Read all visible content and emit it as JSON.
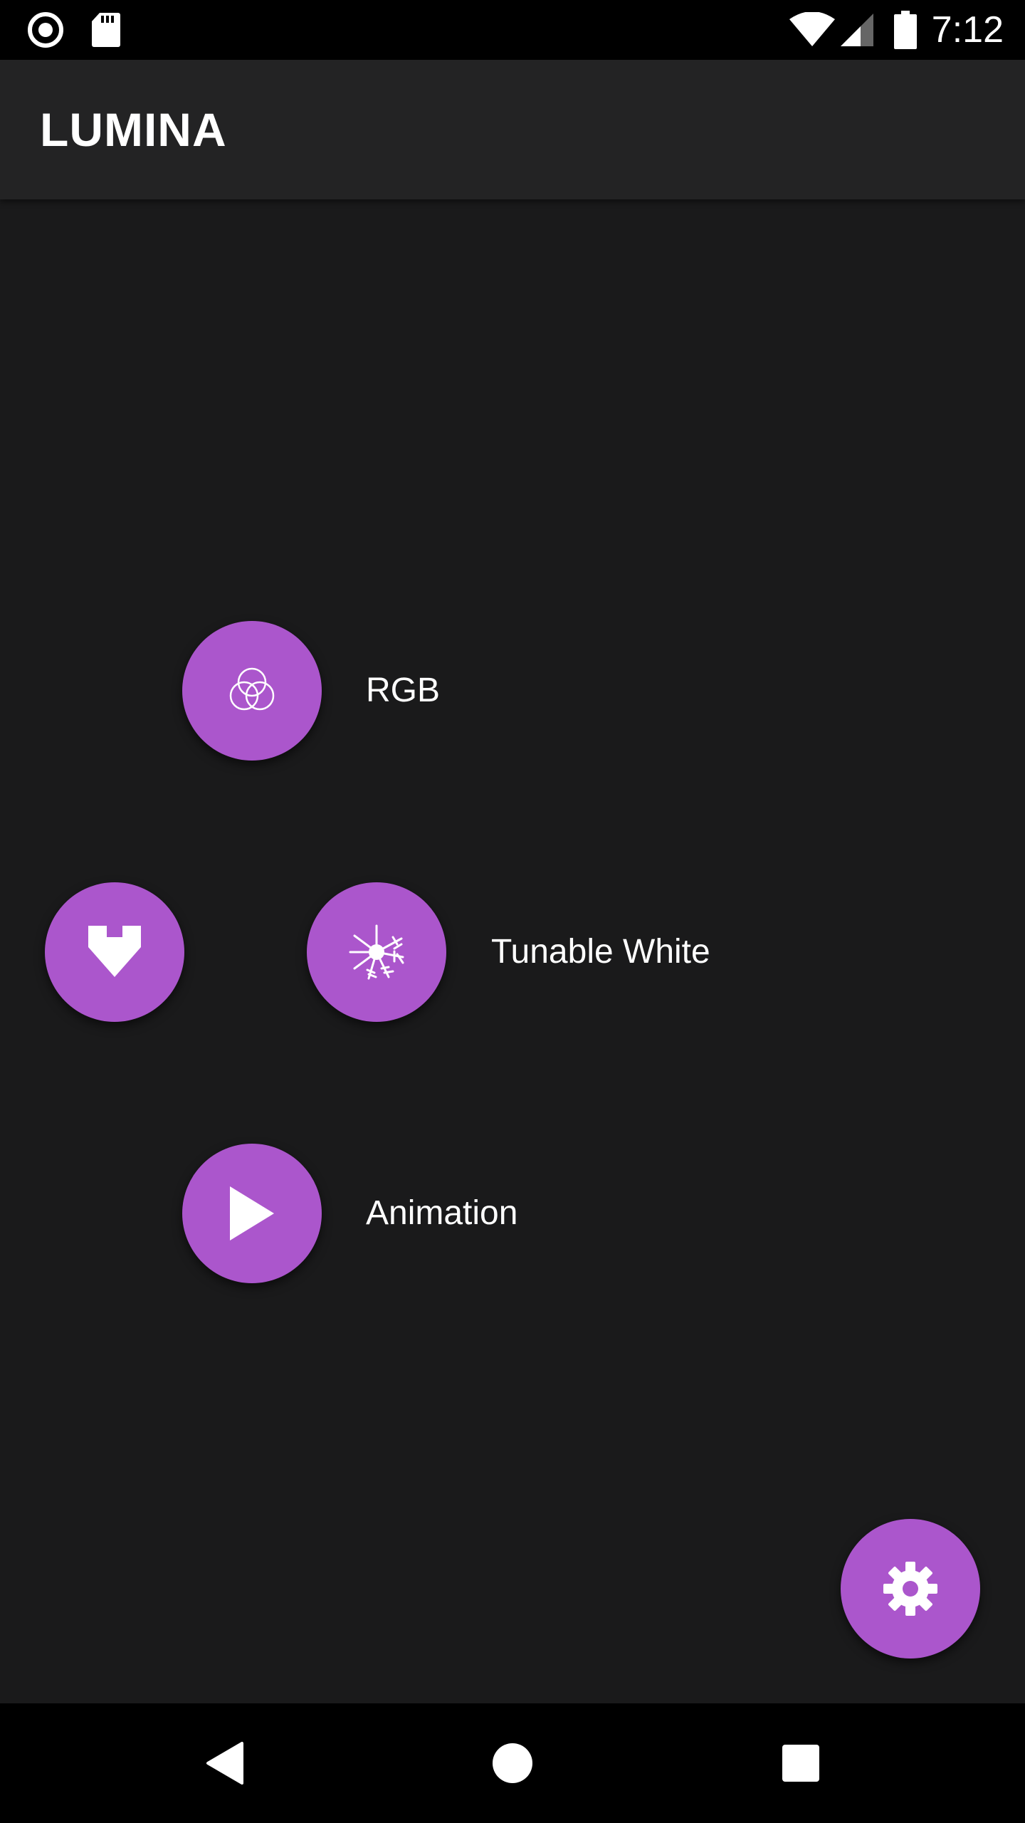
{
  "status_bar": {
    "time": "7:12",
    "icons": [
      "radio-record-icon",
      "sd-card-icon",
      "wifi-icon",
      "cell-signal-icon",
      "battery-icon"
    ]
  },
  "app_bar": {
    "title": "LUMINA"
  },
  "menu": {
    "items": [
      {
        "label": "RGB",
        "icon": "rgb-circles-icon"
      },
      {
        "label": "Tunable White",
        "icon": "sun-snowflake-icon"
      },
      {
        "label": "Animation",
        "icon": "play-icon"
      }
    ],
    "collapse_icon": "arrow-down-icon"
  },
  "settings_fab": {
    "icon": "gear-icon"
  },
  "nav_bar": {
    "icons": [
      "back-icon",
      "home-icon",
      "recents-icon"
    ]
  },
  "colors": {
    "accent": "#ab56cc",
    "background": "#1a1a1b",
    "app_bar": "#232324"
  }
}
